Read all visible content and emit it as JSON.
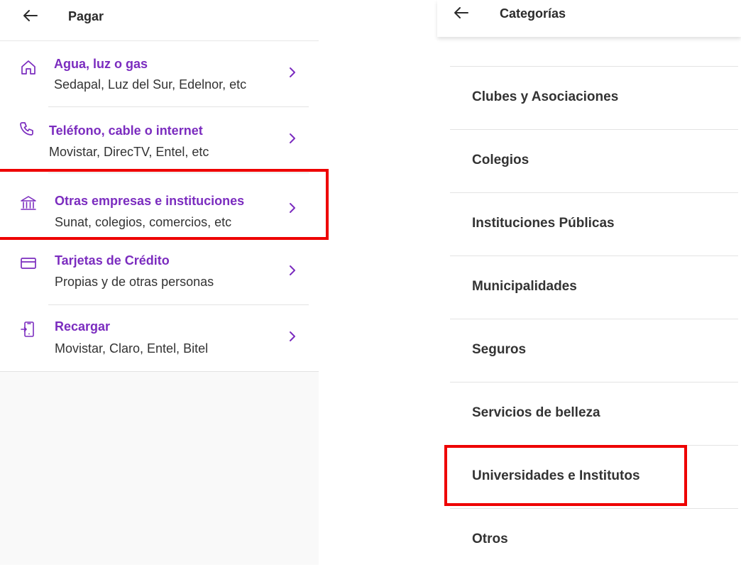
{
  "left": {
    "header": {
      "title": "Pagar"
    },
    "items": [
      {
        "title": "Agua, luz o gas",
        "subtitle": "Sedapal, Luz del Sur, Edelnor, etc",
        "icon": "home-icon"
      },
      {
        "title": "Teléfono, cable o internet",
        "subtitle": "Movistar, DirecTV, Entel, etc",
        "icon": "phone-icon"
      },
      {
        "title": "Otras empresas e instituciones",
        "subtitle": "Sunat, colegios, comercios, etc",
        "icon": "bank-icon"
      },
      {
        "title": "Tarjetas de Crédito",
        "subtitle": "Propias y de otras personas",
        "icon": "credit-card-icon"
      },
      {
        "title": "Recargar",
        "subtitle": "Movistar, Claro, Entel, Bitel",
        "icon": "mobile-recharge-icon"
      }
    ]
  },
  "right": {
    "header": {
      "title": "Categorías"
    },
    "items": [
      {
        "label": "Clubes y Asociaciones"
      },
      {
        "label": "Colegios"
      },
      {
        "label": "Instituciones Públicas"
      },
      {
        "label": "Municipalidades"
      },
      {
        "label": "Seguros"
      },
      {
        "label": "Servicios de belleza"
      },
      {
        "label": "Universidades e Institutos"
      },
      {
        "label": "Otros"
      }
    ]
  },
  "colors": {
    "accent_purple": "#7b2cbf",
    "highlight_red": "#ee0000",
    "text_dark": "#2b2b2b",
    "divider": "#e3e3e3"
  }
}
